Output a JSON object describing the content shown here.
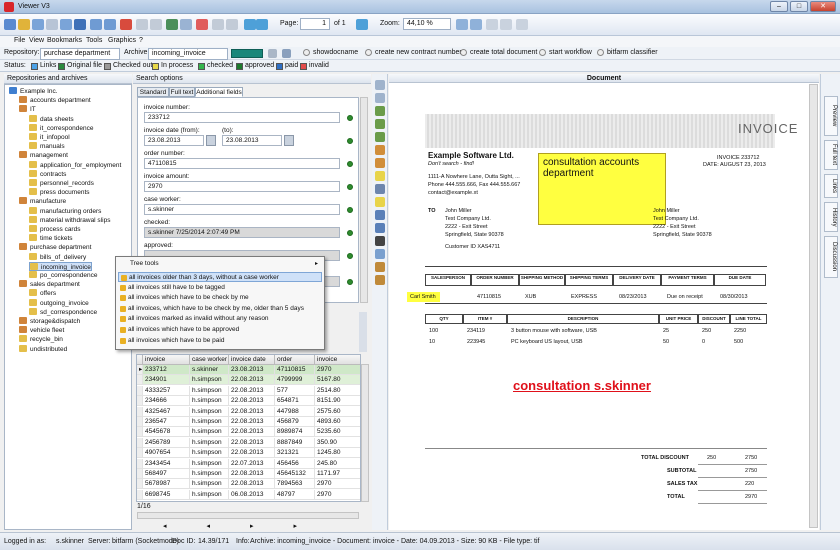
{
  "window": {
    "title": "Viewer V3",
    "minimize": "–",
    "maximize": "□",
    "close": "✕"
  },
  "toolbar": {
    "page_label": "Page:",
    "page_value": "1",
    "page_of": "of 1",
    "zoom_label": "Zoom:",
    "zoom_value": "44,10 %"
  },
  "menu": [
    "File",
    "View",
    "Bookmarks",
    "Tools",
    "Graphics",
    "?"
  ],
  "repobar": {
    "repository_label": "Repository:",
    "repository_value": "purchase department",
    "archive_label": "Archive:",
    "archive_value": "incoming_invoice",
    "actions": [
      "showdocname",
      "create new contract number",
      "create total document",
      "start workflow",
      "bitfarm classifier"
    ]
  },
  "statusbar_top": {
    "label": "Status:",
    "items": [
      {
        "label": "Links",
        "color": "#4da3e8"
      },
      {
        "label": "Original file",
        "color": "#2b8a3e"
      },
      {
        "label": "Checked out",
        "color": "#9a9a9a"
      },
      {
        "label": "In process",
        "color": "#e8d94a"
      },
      {
        "label": "checked",
        "color": "#35b64d"
      },
      {
        "label": "approved",
        "color": "#1d7a2c"
      },
      {
        "label": "paid",
        "color": "#2f6fc4"
      },
      {
        "label": "invalid",
        "color": "#e24b4b"
      }
    ]
  },
  "left_panel": {
    "header": "Repositories and archives",
    "tree": [
      {
        "label": "Example Inc.",
        "level": 0,
        "icon": "globe-icon"
      },
      {
        "label": "accounts department",
        "level": 1,
        "icon": "cabinet-icon"
      },
      {
        "label": "IT",
        "level": 1,
        "icon": "cabinet-icon"
      },
      {
        "label": "data sheets",
        "level": 2,
        "icon": "folder-icon"
      },
      {
        "label": "it_correspondence",
        "level": 2,
        "icon": "folder-icon"
      },
      {
        "label": "it_infopool",
        "level": 2,
        "icon": "folder-icon"
      },
      {
        "label": "manuals",
        "level": 2,
        "icon": "folder-icon"
      },
      {
        "label": "management",
        "level": 1,
        "icon": "cabinet-icon"
      },
      {
        "label": "application_for_employment",
        "level": 2,
        "icon": "folder-icon"
      },
      {
        "label": "contracts",
        "level": 2,
        "icon": "folder-icon"
      },
      {
        "label": "personnel_records",
        "level": 2,
        "icon": "folder-icon"
      },
      {
        "label": "press documents",
        "level": 2,
        "icon": "folder-icon"
      },
      {
        "label": "manufacture",
        "level": 1,
        "icon": "cabinet-icon"
      },
      {
        "label": "manufacturing orders",
        "level": 2,
        "icon": "folder-icon"
      },
      {
        "label": "material withdrawal slips",
        "level": 2,
        "icon": "folder-icon"
      },
      {
        "label": "process cards",
        "level": 2,
        "icon": "folder-icon"
      },
      {
        "label": "time tickets",
        "level": 2,
        "icon": "folder-icon"
      },
      {
        "label": "purchase department",
        "level": 1,
        "icon": "cabinet-icon"
      },
      {
        "label": "bills_of_delivery",
        "level": 2,
        "icon": "folder-icon"
      },
      {
        "label": "incoming_invoice",
        "level": 2,
        "icon": "folder-icon",
        "selected": true
      },
      {
        "label": "po_correspondence",
        "level": 2,
        "icon": "folder-icon"
      },
      {
        "label": "sales department",
        "level": 1,
        "icon": "cabinet-icon"
      },
      {
        "label": "offers",
        "level": 2,
        "icon": "folder-icon"
      },
      {
        "label": "outgoing_invoice",
        "level": 2,
        "icon": "folder-icon"
      },
      {
        "label": "sd_correspondence",
        "level": 2,
        "icon": "folder-icon"
      },
      {
        "label": "storage&dispatch",
        "level": 1,
        "icon": "cabinet-icon"
      },
      {
        "label": "vehicle fleet",
        "level": 1,
        "icon": "cabinet-icon"
      },
      {
        "label": "recycle_bin",
        "level": 1,
        "icon": "folder-icon"
      },
      {
        "label": "undistributed",
        "level": 1,
        "icon": "folder-icon"
      }
    ]
  },
  "search_panel": {
    "header": "Search options",
    "tabs": [
      "Standard",
      "Full text",
      "Additional fields"
    ],
    "fields": {
      "invoice_number_label": "invoice number:",
      "invoice_number": "233712",
      "invoice_date_label": "invoice date (from):",
      "invoice_date_from": "23.08.2013",
      "invoice_date_to_label": "(to):",
      "invoice_date_to": "23.08.2013",
      "order_number_label": "order number:",
      "order_number": "47110815",
      "invoice_amount_label": "invoice amount:",
      "invoice_amount": "2970",
      "case_worker_label": "case worker:",
      "case_worker": "s.skinner",
      "checked_label": "checked:",
      "checked_value": "s.skinner 7/25/2014 2:07:49 PM",
      "approved_label": "approved:"
    }
  },
  "context_menu": {
    "title": "Tree tools",
    "items": [
      "all invoices older than 3 days, without a case worker",
      "all invoices still have to be tagged",
      "all invoices which have to be check by me",
      "all invoices, which have to be check by me, older than 5 days",
      "all invoices marked as invalid without any reason",
      "all invoices which have to be approved",
      "all invoices which have to be paid"
    ]
  },
  "results_grid": {
    "columns": [
      "invoice number",
      "case worker",
      "invoice date",
      "order number",
      "invoice amount"
    ],
    "rows": [
      [
        "233712",
        "s.skinner",
        "23.08.2013",
        "47110815",
        "2970"
      ],
      [
        "234901",
        "h.simpson",
        "22.08.2013",
        "4799999",
        "5167.80"
      ],
      [
        "4333257",
        "h.simpson",
        "22.08.2013",
        "577",
        "2514.80"
      ],
      [
        "234666",
        "h.simpson",
        "22.08.2013",
        "654871",
        "8151.90"
      ],
      [
        "4325467",
        "h.simpson",
        "22.08.2013",
        "447988",
        "2575.60"
      ],
      [
        "236547",
        "h.simpson",
        "22.08.2013",
        "456879",
        "4893.60"
      ],
      [
        "4545678",
        "h.simpson",
        "22.08.2013",
        "8989874",
        "5235.60"
      ],
      [
        "2456789",
        "h.simpson",
        "22.08.2013",
        "8887849",
        "350.90"
      ],
      [
        "4907654",
        "h.simpson",
        "22.08.2013",
        "321321",
        "1245.80"
      ],
      [
        "2343454",
        "h.simpson",
        "22.07.2013",
        "456456",
        "245.80"
      ],
      [
        "568497",
        "h.simpson",
        "22.08.2013",
        "45645132",
        "1171.97"
      ],
      [
        "5678987",
        "h.simpson",
        "22.08.2013",
        "7894563",
        "2970"
      ],
      [
        "6698745",
        "h.simpson",
        "06.08.2013",
        "48797",
        "2970"
      ]
    ],
    "pager": "1/16"
  },
  "document": {
    "header": "Document",
    "invoice_title": "INVOICE",
    "invoice_number_line": "INVOICE   233712",
    "date_line": "DATE: AUGUST 23, 2013",
    "company": "Example Software Ltd.",
    "slogan": "Don't search - find!",
    "address": [
      "1111-A Nowhere Lane, Outta Sight, ...",
      "Phone 444.555.666, Fax 444.555.667",
      "contact@example.xt"
    ],
    "to_label": "TO",
    "to_address": [
      "John Miller",
      "Test Company Ltd.",
      "2222 - Exit Street",
      "Springfield, State 90378"
    ],
    "ship_address": [
      "John Miller",
      "Test Company Ltd.",
      "2222 - Exit Street",
      "Springfield, State 90378"
    ],
    "customer_id": "Customer ID XAS4711",
    "note_consultation": "consultation accounts department",
    "order_headers": [
      "SALESPERSON",
      "ORDER NUMBER",
      "SHIPPING METHOD",
      "SHIPPING TERMS",
      "DELIVERY DATE",
      "PAYMENT TERMS",
      "DUE DATE"
    ],
    "order_values": [
      "Carl Smith",
      "47110815",
      "XUB",
      "EXPRESS",
      "08/23/2013",
      "Due on receipt",
      "08/30/2013"
    ],
    "item_headers": [
      "QTY",
      "ITEM #",
      "DESCRIPTION",
      "UNIT PRICE",
      "DISCOUNT",
      "LINE TOTAL"
    ],
    "items": [
      [
        "100",
        "234119",
        "3 button mouse with software, USB",
        "25",
        "250",
        "2250"
      ],
      [
        "10",
        "223945",
        "PC keyboard US layout, USB",
        "50",
        "0",
        "500"
      ]
    ],
    "stamp": "consultation s.skinner",
    "totals": [
      [
        "TOTAL DISCOUNT",
        "250",
        "2750"
      ],
      [
        "SUBTOTAL",
        "",
        "2750"
      ],
      [
        "SALES TAX",
        "",
        "220"
      ],
      [
        "TOTAL",
        "",
        "2970"
      ]
    ]
  },
  "right_rail": [
    "Preview",
    "Full text",
    "Links",
    "History",
    "Discussion"
  ],
  "statusbar": {
    "logged_label": "Logged in as:",
    "user": "s.skinner",
    "server_label": "Server:",
    "server": "bitfarm (Socketmode)",
    "docid_label": "Doc ID:",
    "docid": "14.39/171",
    "info_label": "Info:",
    "info": "Archive: incoming_invoice - Document: invoice - Date: 04.09.2013 - Size: 90 KB - File type: tif"
  }
}
